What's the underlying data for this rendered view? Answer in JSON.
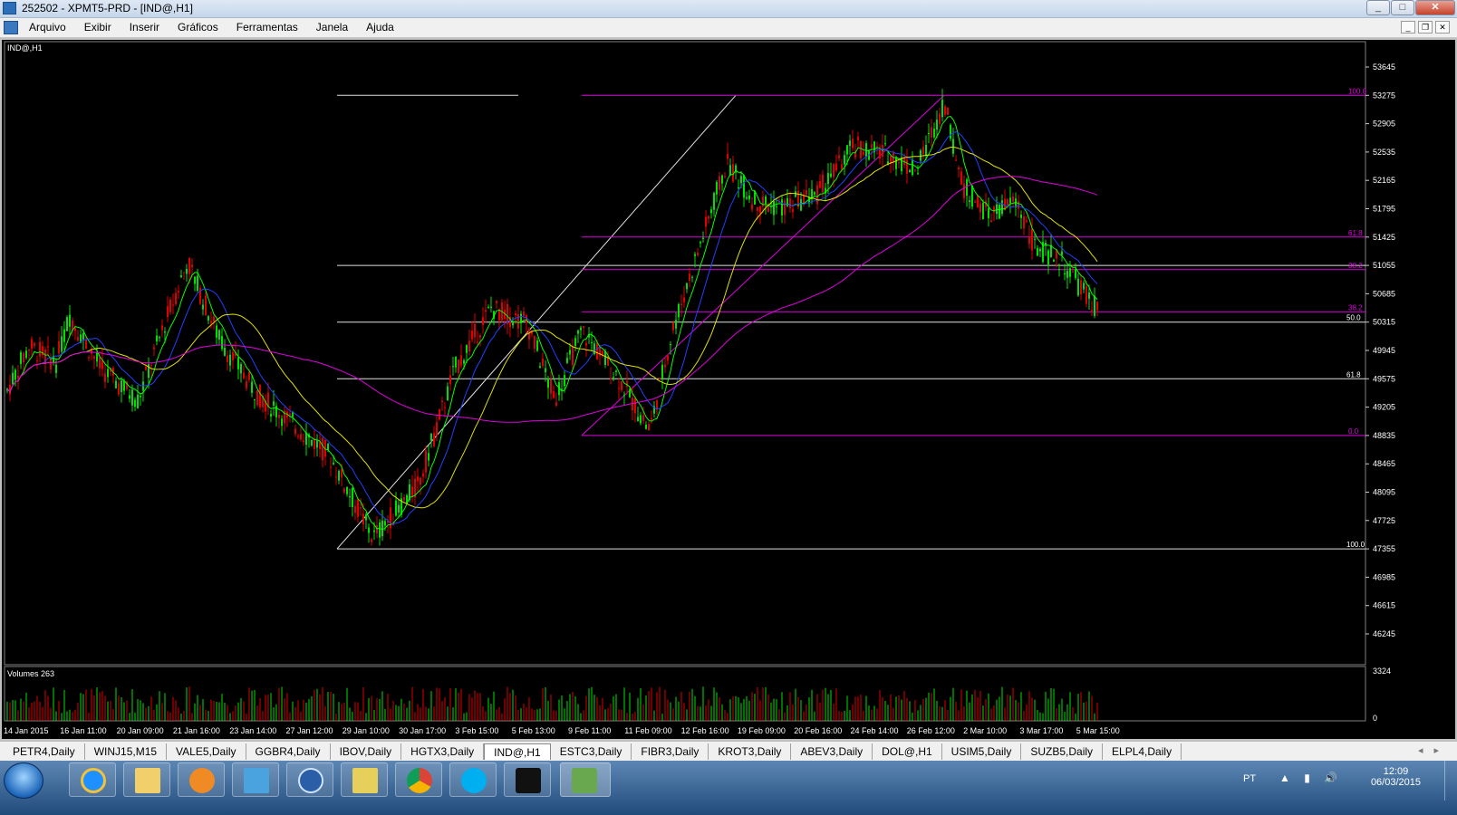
{
  "window": {
    "title": "252502 - XPMT5-PRD - [IND@,H1]"
  },
  "menu": {
    "items": [
      "Arquivo",
      "Exibir",
      "Inserir",
      "Gráficos",
      "Ferramentas",
      "Janela",
      "Ajuda"
    ]
  },
  "chart": {
    "symbol_label": "IND@,H1",
    "volume_label": "Volumes 263",
    "price_ticks": [
      "53645",
      "53275",
      "52905",
      "52535",
      "52165",
      "51795",
      "51425",
      "51055",
      "50685",
      "50315",
      "49945",
      "49575",
      "49205",
      "48835",
      "48465",
      "48095",
      "47725",
      "47355",
      "46985",
      "46615",
      "46245"
    ],
    "volume_ticks": [
      "3324",
      "0"
    ],
    "time_labels": [
      "14 Jan 2015",
      "16 Jan 11:00",
      "20 Jan 09:00",
      "21 Jan 16:00",
      "23 Jan 14:00",
      "27 Jan 12:00",
      "29 Jan 10:00",
      "30 Jan 17:00",
      "3 Feb 15:00",
      "5 Feb 13:00",
      "9 Feb 11:00",
      "11 Feb 09:00",
      "12 Feb 16:00",
      "19 Feb 09:00",
      "20 Feb 16:00",
      "24 Feb 14:00",
      "26 Feb 12:00",
      "2 Mar 10:00",
      "3 Mar 17:00",
      "5 Mar 15:00"
    ],
    "fib_white_labels": [
      "61.8",
      "50.0",
      "100.0"
    ],
    "fib_magenta_labels": [
      "100.0",
      "61.8",
      "38.2",
      "38.2",
      "0.0"
    ],
    "colors": {
      "bull": "#00e000",
      "bear": "#e00000",
      "ma_green": "#00ff00",
      "ma_blue": "#2040ff",
      "ma_yellow": "#e0e000",
      "ma_magenta": "#e000e0",
      "fib_white": "#e0e0e0",
      "fib_magenta": "#e000e0"
    }
  },
  "tabs": {
    "items": [
      "PETR4,Daily",
      "WINJ15,M15",
      "VALE5,Daily",
      "GGBR4,Daily",
      "IBOV,Daily",
      "HGTX3,Daily",
      "IND@,H1",
      "ESTC3,Daily",
      "FIBR3,Daily",
      "KROT3,Daily",
      "ABEV3,Daily",
      "DOL@,H1",
      "USIM5,Daily",
      "SUZB5,Daily",
      "ELPL4,Daily"
    ],
    "active": "IND@,H1"
  },
  "taskbar": {
    "apps": [
      "start-orb-icon",
      "internet-explorer-icon",
      "file-explorer-icon",
      "media-player-icon",
      "flag-icon",
      "hp-icon",
      "notes-icon",
      "chrome-icon",
      "skype-icon",
      "xp-icon",
      "metatrader-icon"
    ],
    "lang": "PT",
    "time": "12:09",
    "date": "06/03/2015"
  }
}
